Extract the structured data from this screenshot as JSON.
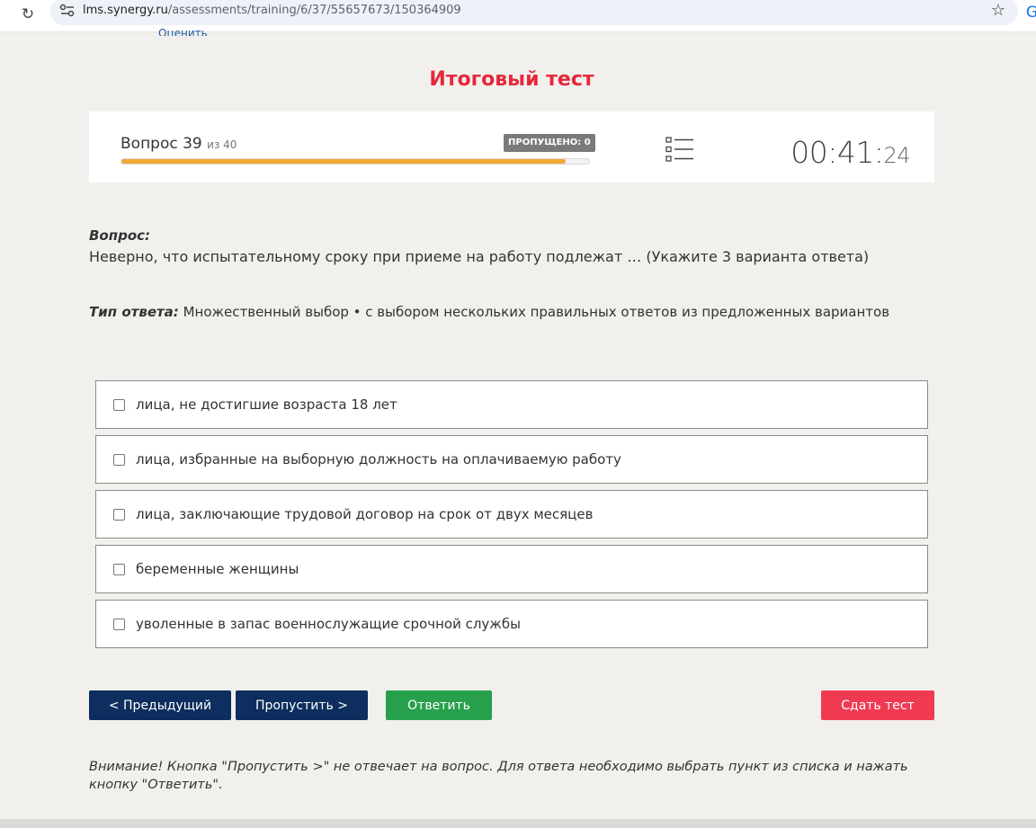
{
  "browser": {
    "url_host": "lms.synergy.ru",
    "url_path": "/assessments/training/6/37/55657673/150364909",
    "edge_glyph": "G"
  },
  "top_link": "Оценить",
  "page_title": "Итоговый тест",
  "status": {
    "question_label": "Вопрос 39",
    "question_of": "из 40",
    "progress_fraction": 0.95,
    "skipped": "ПРОПУЩЕНО: 0",
    "timer_main": "00:41:",
    "timer_sec": "24"
  },
  "question": {
    "label": "Вопрос:",
    "text": "Неверно, что испытательному сроку при приеме на работу подлежат … (Укажите 3 варианта ответа)",
    "type_label": "Тип ответа:",
    "type_value": " Множественный выбор • с выбором нескольких правильных ответов из предложенных вариантов"
  },
  "options": [
    "лица, не достигшие возраста 18 лет",
    "лица, избранные на выборную должность на оплачиваемую работу",
    "лица, заключающие трудовой договор на срок от двух месяцев",
    "беременные женщины",
    "уволенные в запас военнослужащие срочной службы"
  ],
  "buttons": {
    "prev": "< Предыдущий",
    "skip": "Пропустить >",
    "answer": "Ответить",
    "finish": "Сдать тест"
  },
  "notice": "Внимание! Кнопка \"Пропустить >\" не отвечает на вопрос. Для ответа необходимо выбрать пункт из списка и нажать кнопку \"Ответить\".",
  "colors": {
    "title": "#e6283c",
    "progress": "#f0aa34",
    "nav_button": "#0d2e5e",
    "answer_button": "#27a04c",
    "finish_button": "#f03a52"
  }
}
